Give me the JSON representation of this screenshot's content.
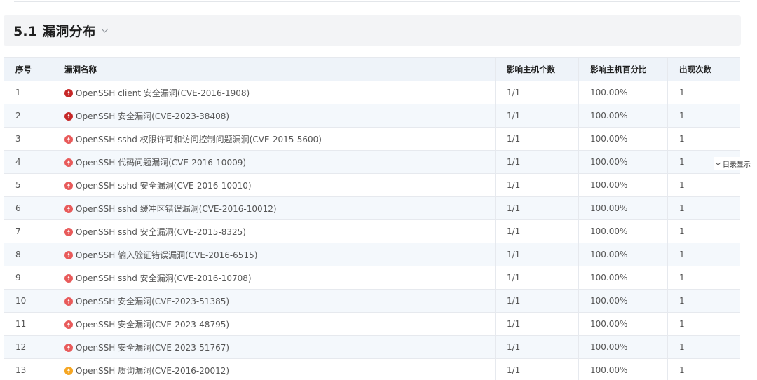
{
  "section": {
    "title": "5.1 漏洞分布"
  },
  "toc": {
    "label": "目录显示"
  },
  "colors": {
    "critical": "#c62828",
    "high": "#e85a5a",
    "medium": "#f5a623"
  },
  "table": {
    "headers": [
      "序号",
      "漏洞名称",
      "影响主机个数",
      "影响主机百分比",
      "出现次数"
    ],
    "rows": [
      {
        "no": "1",
        "name": "OpenSSH client 安全漏洞(CVE-2016-1908)",
        "level": "critical",
        "hosts": "1/1",
        "percent": "100.00%",
        "count": "1"
      },
      {
        "no": "2",
        "name": "OpenSSH 安全漏洞(CVE-2023-38408)",
        "level": "critical",
        "hosts": "1/1",
        "percent": "100.00%",
        "count": "1"
      },
      {
        "no": "3",
        "name": "OpenSSH sshd 权限许可和访问控制问题漏洞(CVE-2015-5600)",
        "level": "high",
        "hosts": "1/1",
        "percent": "100.00%",
        "count": "1"
      },
      {
        "no": "4",
        "name": "OpenSSH 代码问题漏洞(CVE-2016-10009)",
        "level": "high",
        "hosts": "1/1",
        "percent": "100.00%",
        "count": "1"
      },
      {
        "no": "5",
        "name": "OpenSSH sshd 安全漏洞(CVE-2016-10010)",
        "level": "high",
        "hosts": "1/1",
        "percent": "100.00%",
        "count": "1"
      },
      {
        "no": "6",
        "name": "OpenSSH sshd 缓冲区错误漏洞(CVE-2016-10012)",
        "level": "high",
        "hosts": "1/1",
        "percent": "100.00%",
        "count": "1"
      },
      {
        "no": "7",
        "name": "OpenSSH sshd 安全漏洞(CVE-2015-8325)",
        "level": "high",
        "hosts": "1/1",
        "percent": "100.00%",
        "count": "1"
      },
      {
        "no": "8",
        "name": "OpenSSH 输入验证错误漏洞(CVE-2016-6515)",
        "level": "high",
        "hosts": "1/1",
        "percent": "100.00%",
        "count": "1"
      },
      {
        "no": "9",
        "name": "OpenSSH sshd 安全漏洞(CVE-2016-10708)",
        "level": "high",
        "hosts": "1/1",
        "percent": "100.00%",
        "count": "1"
      },
      {
        "no": "10",
        "name": "OpenSSH 安全漏洞(CVE-2023-51385)",
        "level": "high",
        "hosts": "1/1",
        "percent": "100.00%",
        "count": "1"
      },
      {
        "no": "11",
        "name": "OpenSSH 安全漏洞(CVE-2023-48795)",
        "level": "high",
        "hosts": "1/1",
        "percent": "100.00%",
        "count": "1"
      },
      {
        "no": "12",
        "name": "OpenSSH 安全漏洞(CVE-2023-51767)",
        "level": "high",
        "hosts": "1/1",
        "percent": "100.00%",
        "count": "1"
      },
      {
        "no": "13",
        "name": "OpenSSH 质询漏洞(CVE-2016-20012)",
        "level": "medium",
        "hosts": "1/1",
        "percent": "100.00%",
        "count": "1"
      }
    ]
  }
}
